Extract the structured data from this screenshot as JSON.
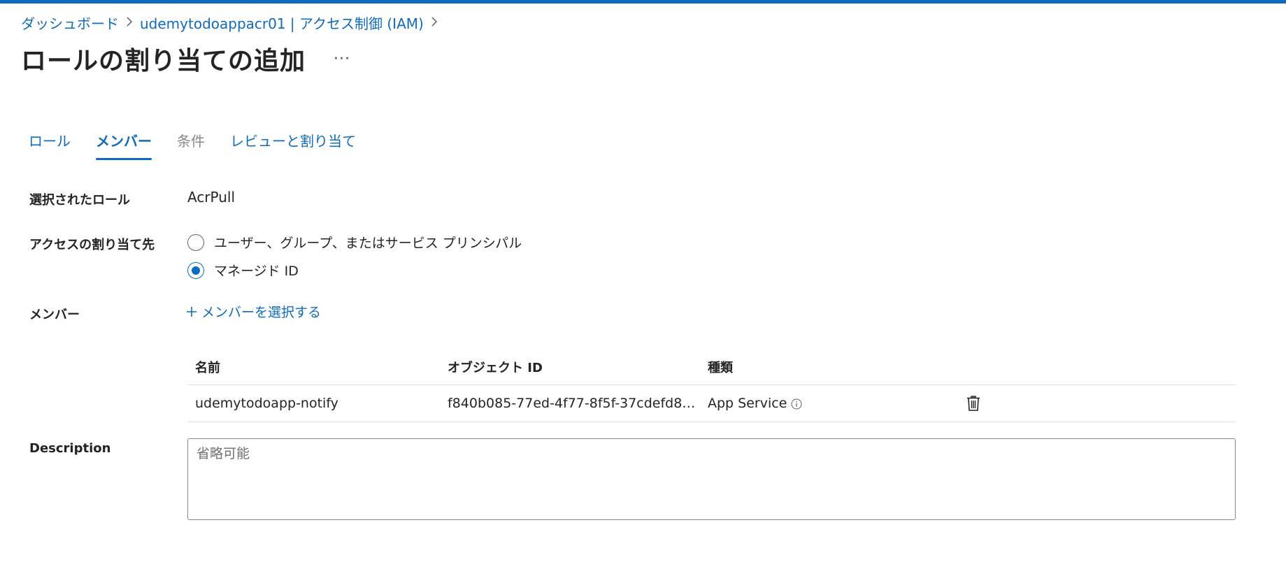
{
  "colors": {
    "accent": "#0f6cbd",
    "text": "#242424",
    "disabled": "#8a8886",
    "border": "#e1dfdd"
  },
  "breadcrumb": {
    "items": [
      "ダッシュボード",
      "udemytodoappacr01 | アクセス制御 (IAM)"
    ]
  },
  "header": {
    "title": "ロールの割り当ての追加",
    "more_label": "···"
  },
  "tabs": [
    {
      "label": "ロール",
      "state": "normal"
    },
    {
      "label": "メンバー",
      "state": "active"
    },
    {
      "label": "条件",
      "state": "disabled"
    },
    {
      "label": "レビューと割り当て",
      "state": "normal"
    }
  ],
  "form": {
    "selected_role_label": "選択されたロール",
    "selected_role_value": "AcrPull",
    "assign_access_label": "アクセスの割り当て先",
    "assign_options": [
      {
        "label": "ユーザー、グループ、またはサービス プリンシパル",
        "checked": false
      },
      {
        "label": "マネージド ID",
        "checked": true
      }
    ],
    "members_label": "メンバー",
    "select_members_label": "メンバーを選択する",
    "description_label": "Description",
    "description_placeholder": "省略可能",
    "description_value": ""
  },
  "members_table": {
    "headers": [
      "名前",
      "オブジェクト ID",
      "種類"
    ],
    "rows": [
      {
        "name": "udemytodoapp-notify",
        "object_id": "f840b085-77ed-4f77-8f5f-37cdefd8…",
        "type": "App Service"
      }
    ]
  },
  "icons": {
    "info": "info-icon",
    "delete": "trash-icon",
    "add": "plus-icon",
    "chevron": "chevron-right-icon"
  }
}
